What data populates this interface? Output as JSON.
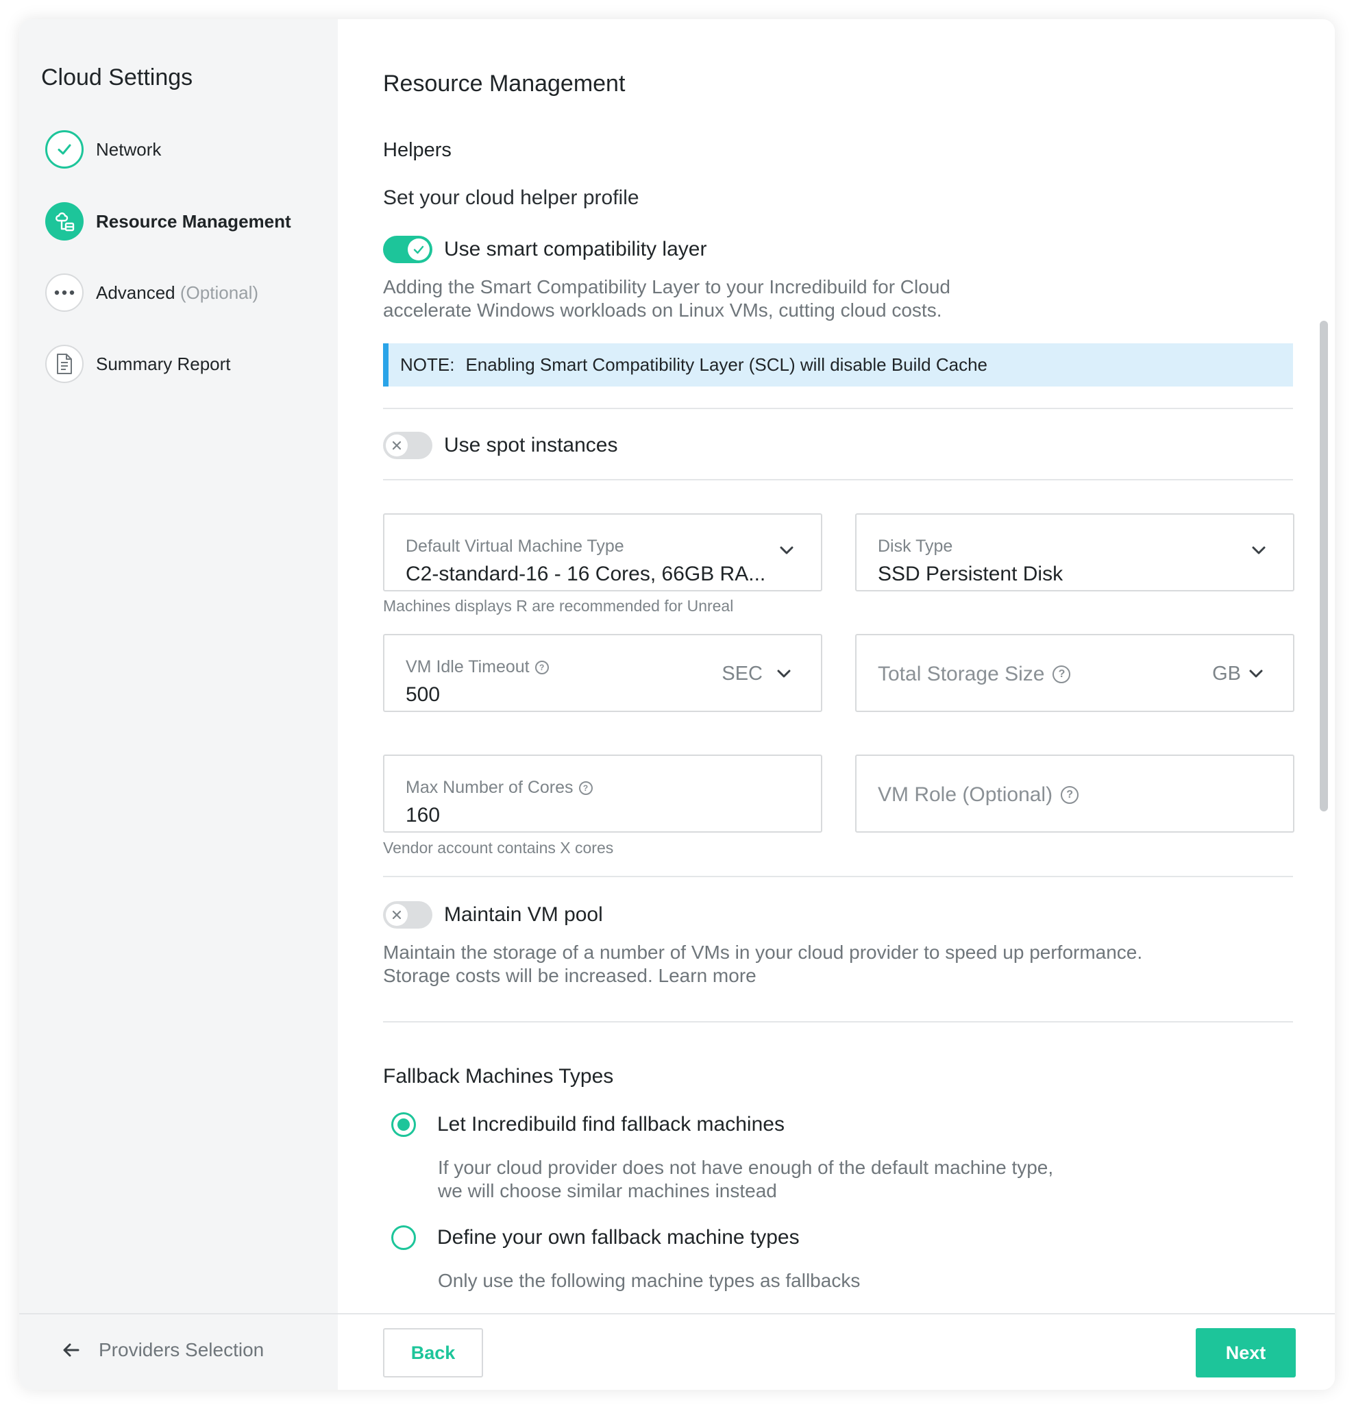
{
  "sidebar": {
    "title": "Cloud Settings",
    "steps": [
      {
        "label": "Network",
        "status": "done",
        "icon": "check-icon"
      },
      {
        "label": "Resource Management",
        "status": "active",
        "icon": "cloud-resources-icon"
      },
      {
        "label": "Advanced",
        "optional": "(Optional)",
        "status": "todo",
        "icon": "more-dots-icon"
      },
      {
        "label": "Summary Report",
        "status": "todo",
        "icon": "document-icon"
      }
    ]
  },
  "main": {
    "title": "Resource Management",
    "helpers": {
      "title": "Helpers",
      "subtitle": "Set your cloud helper profile",
      "scl_toggle": {
        "label": "Use smart compatibility layer",
        "on": true
      },
      "scl_desc": [
        "Adding the Smart Compatibility Layer to your Incredibuild for Cloud",
        "accelerate Windows workloads on Linux VMs, cutting cloud costs."
      ],
      "note_label": "NOTE:",
      "note_text": "Enabling Smart Compatibility Layer (SCL) will disable Build Cache",
      "spot_toggle": {
        "label": "Use spot instances",
        "on": false
      }
    },
    "fields": {
      "vm_type": {
        "label": "Default Virtual Machine Type",
        "value": "C2-standard-16 - 16 Cores, 66GB RA..."
      },
      "vm_type_hint": "Machines displays R are recommended for Unreal",
      "disk_type": {
        "label": "Disk Type",
        "value": "SSD Persistent Disk"
      },
      "idle_timeout": {
        "label": "VM Idle Timeout",
        "value": "500",
        "unit": "SEC"
      },
      "storage": {
        "placeholder": "Total Storage Size",
        "unit": "GB"
      },
      "max_cores": {
        "label": "Max Number of Cores",
        "value": "160"
      },
      "max_cores_hint": "Vendor account contains X cores",
      "vm_role": {
        "placeholder": "VM Role (Optional)"
      }
    },
    "pool_toggle": {
      "label": "Maintain VM pool",
      "on": false
    },
    "pool_desc": [
      "Maintain the storage of a number of VMs in your cloud provider to speed up performance.",
      "Storage costs will be increased. Learn more"
    ],
    "fallback": {
      "title": "Fallback Machines Types",
      "options": [
        {
          "label": "Let Incredibuild find fallback machines",
          "selected": true,
          "desc": [
            "If your cloud provider does not have enough of the default machine type,",
            "we will choose similar machines instead"
          ]
        },
        {
          "label": "Define your own fallback machine types",
          "selected": false,
          "desc": [
            "Only use the following machine types as fallbacks"
          ]
        }
      ]
    }
  },
  "footer": {
    "back_link": "Providers Selection",
    "back_button": "Back",
    "next_button": "Next"
  },
  "colors": {
    "accent": "#1dc59a",
    "note_bg": "#dbeffb",
    "note_border": "#2aa4e8"
  }
}
